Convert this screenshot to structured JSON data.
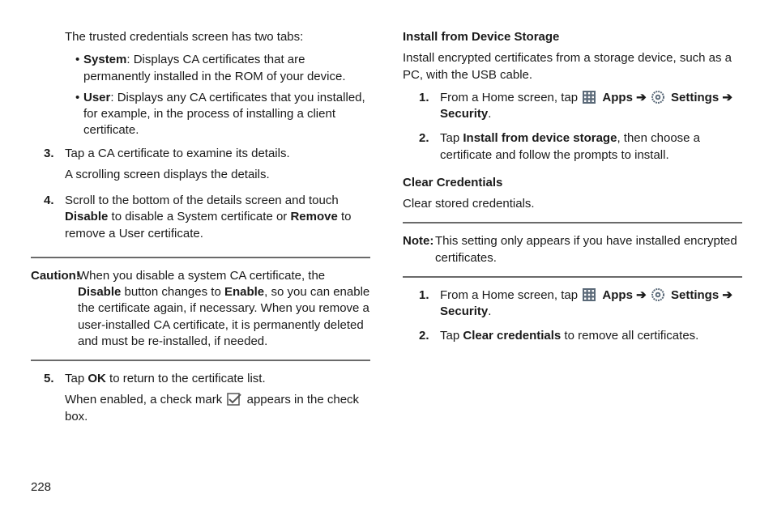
{
  "pageNumber": "228",
  "left": {
    "intro": "The trusted credentials screen has two tabs:",
    "bullets": [
      {
        "label": "System",
        "text": ": Displays CA certificates that are permanently installed in the ROM of your device."
      },
      {
        "label": "User",
        "text": ": Displays any CA certificates that you installed, for example, in the process of installing a client certificate."
      }
    ],
    "steps": {
      "s3": {
        "num": "3.",
        "l1": "Tap a CA certificate to examine its details.",
        "l2": "A scrolling screen displays the details."
      },
      "s4": {
        "num": "4.",
        "pre": "Scroll to the bottom of the details screen and touch ",
        "b1": "Disable",
        "mid1": " to disable a System certificate or ",
        "b2": "Remove",
        "post": " to remove a User certificate."
      },
      "s5": {
        "num": "5.",
        "pre": "Tap ",
        "b1": "OK",
        "post": " to return to the certificate list.",
        "l2a": "When enabled, a check mark ",
        "l2b": " appears in the check box."
      }
    },
    "caution": {
      "label": "Caution!",
      "pre": " When you disable a system CA certificate, the ",
      "b1": "Disable",
      "mid1": " button changes to ",
      "b2": "Enable",
      "post": ", so you can enable the certificate again, if necessary. When you remove a user-installed CA certificate, it is permanently deleted and must be re-installed, if needed."
    }
  },
  "right": {
    "install": {
      "heading": "Install from Device Storage",
      "intro": "Install encrypted certificates from a storage device, such as a PC, with the USB cable.",
      "s1": {
        "num": "1.",
        "pre": "From a Home screen, tap ",
        "apps": "Apps",
        "settings": "Settings",
        "tail_arrow": "➔ ",
        "tail_b": "Security",
        "tail_dot": "."
      },
      "s2": {
        "num": "2.",
        "pre": "Tap ",
        "b": "Install from device storage",
        "post": ", then choose a certificate and follow the prompts to install."
      }
    },
    "clear": {
      "heading": "Clear Credentials",
      "intro": "Clear stored credentials.",
      "note": {
        "label": "Note:",
        "text": " This setting only appears if you have installed encrypted certificates."
      },
      "s1": {
        "num": "1.",
        "pre": "From a Home screen, tap ",
        "apps": "Apps",
        "settings": "Settings",
        "tail_arrow": "➔ ",
        "tail_b": "Security",
        "tail_dot": "."
      },
      "s2": {
        "num": "2.",
        "pre": "Tap ",
        "b": "Clear credentials",
        "post": " to remove all certificates."
      }
    },
    "arrow": "➔"
  }
}
